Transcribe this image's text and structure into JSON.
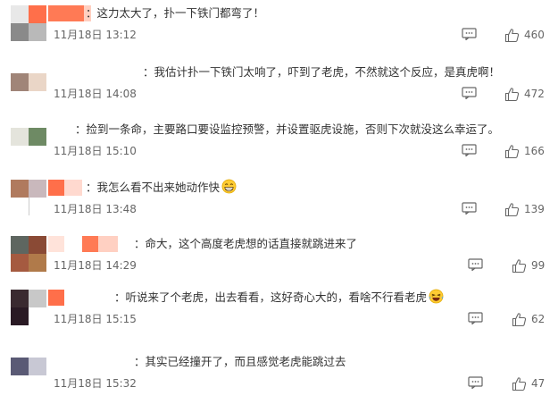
{
  "comments": [
    {
      "text": "：这力太大了，扑一下铁门都弯了！",
      "time": "11月18日 13:12",
      "likes": "460",
      "emoji": null,
      "avatar_colors": [
        "#e8e8e8",
        "#ff6f4a",
        "#8a8a8a",
        "#b9b9b9"
      ]
    },
    {
      "text": "：我估计扑一下铁门太响了，吓到了老虎，不然就这个反应，是真虎啊！",
      "time": "11月18日 14:08",
      "likes": "472",
      "emoji": null,
      "avatar_colors": [
        "#a08578",
        "#ead6c7",
        "#ffffff",
        "#ffffff"
      ]
    },
    {
      "text": "：捡到一条命，主要路口要设监控预警，并设置驱虎设施，否则下次就没这么幸运了。",
      "time": "11月18日 15:10",
      "likes": "166",
      "emoji": null,
      "avatar_colors": [
        "#e4e4dc",
        "#6e8a64",
        "#ffffff",
        "#ffffff"
      ]
    },
    {
      "text": "：我怎么看不出来她动作快",
      "time": "11月18日 13:48",
      "likes": "139",
      "emoji": "grinning-face-emoji",
      "avatar_colors": [
        "#b07a5e",
        "#c9b8bc",
        "#ff6f4a",
        "#ffd9cf"
      ]
    },
    {
      "text": "：命大，这个高度老虎想的话直接就跳进来了",
      "time": "11月18日 14:29",
      "likes": "99",
      "emoji": null,
      "avatar_colors": [
        "#5e6660",
        "#8a4a35",
        "#a55a40",
        "#b07a4a"
      ]
    },
    {
      "text": "：听说来了个老虎，出去看看，这好奇心大的，看啥不行看老虎",
      "time": "11月18日 15:15",
      "likes": "62",
      "emoji": "laughing-tears-emoji",
      "avatar_colors": [
        "#3a2a30",
        "#c8c8c8",
        "#2a1a24",
        "#ffffff"
      ]
    },
    {
      "text": "：其实已经撞开了，而且感觉老虎能跳过去",
      "time": "11月18日 15:32",
      "likes": "47",
      "emoji": null,
      "avatar_colors": [
        "#5a5a75",
        "#c8c8d4",
        "#ffffff",
        "#ffffff"
      ]
    }
  ],
  "colors": {
    "text": "#333333",
    "meta": "#666666",
    "icon": "#666666"
  }
}
